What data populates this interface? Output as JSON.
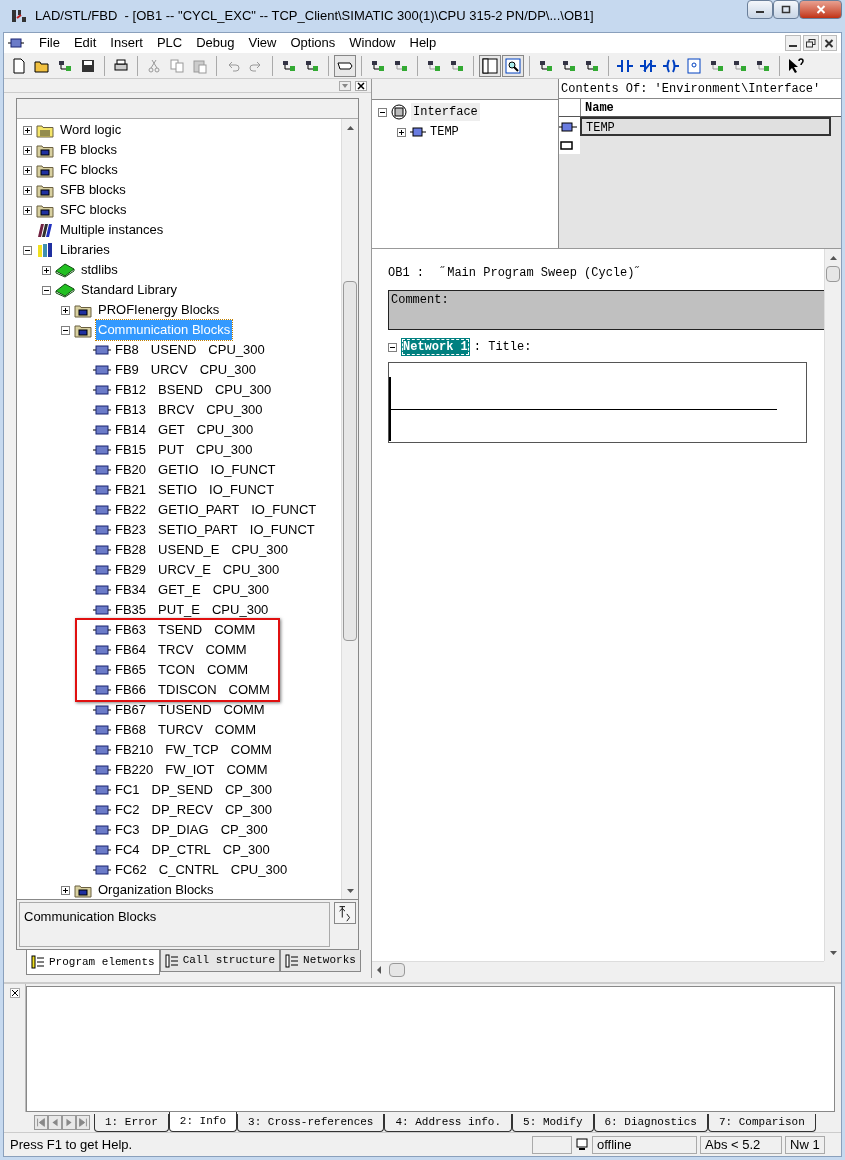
{
  "window": {
    "title": "LAD/STL/FBD  - [OB1 -- \"CYCL_EXC\" -- TCP_Client\\SIMATIC 300(1)\\CPU 315-2 PN/DP\\...\\OB1]"
  },
  "menu": [
    "File",
    "Edit",
    "Insert",
    "PLC",
    "Debug",
    "View",
    "Options",
    "Window",
    "Help"
  ],
  "tree": [
    {
      "label": "Word logic",
      "kind": "logic",
      "expanded": false,
      "selected": false
    },
    {
      "label": "FB blocks",
      "kind": "folder",
      "expanded": false,
      "selected": false
    },
    {
      "label": "FC blocks",
      "kind": "folder",
      "expanded": false,
      "selected": false
    },
    {
      "label": "SFB blocks",
      "kind": "folder",
      "expanded": false,
      "selected": false
    },
    {
      "label": "SFC blocks",
      "kind": "folder",
      "expanded": false,
      "selected": false
    },
    {
      "label": "Multiple instances",
      "kind": "instances",
      "selected": false
    },
    {
      "label": "Libraries",
      "kind": "libraries",
      "expanded": true,
      "selected": false,
      "children": [
        {
          "label": "stdlibs",
          "kind": "book",
          "expanded": false,
          "selected": false
        },
        {
          "label": "Standard Library",
          "kind": "book",
          "expanded": true,
          "selected": false,
          "children": [
            {
              "label": "PROFIenergy Blocks",
              "kind": "folder",
              "expanded": false,
              "selected": false
            },
            {
              "label": "Communication Blocks",
              "kind": "folder",
              "expanded": true,
              "selected": true,
              "blocks": [
                {
                  "number": "FB8",
                  "name": "USEND",
                  "family": "CPU_300",
                  "highlighted": false
                },
                {
                  "number": "FB9",
                  "name": "URCV",
                  "family": "CPU_300",
                  "highlighted": false
                },
                {
                  "number": "FB12",
                  "name": "BSEND",
                  "family": "CPU_300",
                  "highlighted": false
                },
                {
                  "number": "FB13",
                  "name": "BRCV",
                  "family": "CPU_300",
                  "highlighted": false
                },
                {
                  "number": "FB14",
                  "name": "GET",
                  "family": "CPU_300",
                  "highlighted": false
                },
                {
                  "number": "FB15",
                  "name": "PUT",
                  "family": "CPU_300",
                  "highlighted": false
                },
                {
                  "number": "FB20",
                  "name": "GETIO",
                  "family": "IO_FUNCT",
                  "highlighted": false
                },
                {
                  "number": "FB21",
                  "name": "SETIO",
                  "family": "IO_FUNCT",
                  "highlighted": false
                },
                {
                  "number": "FB22",
                  "name": "GETIO_PART",
                  "family": "IO_FUNCT",
                  "highlighted": false
                },
                {
                  "number": "FB23",
                  "name": "SETIO_PART",
                  "family": "IO_FUNCT",
                  "highlighted": false
                },
                {
                  "number": "FB28",
                  "name": "USEND_E",
                  "family": "CPU_300",
                  "highlighted": false
                },
                {
                  "number": "FB29",
                  "name": "URCV_E",
                  "family": "CPU_300",
                  "highlighted": false
                },
                {
                  "number": "FB34",
                  "name": "GET_E",
                  "family": "CPU_300",
                  "highlighted": false
                },
                {
                  "number": "FB35",
                  "name": "PUT_E",
                  "family": "CPU_300",
                  "highlighted": false
                },
                {
                  "number": "FB63",
                  "name": "TSEND",
                  "family": "COMM",
                  "highlighted": true
                },
                {
                  "number": "FB64",
                  "name": "TRCV",
                  "family": "COMM",
                  "highlighted": true
                },
                {
                  "number": "FB65",
                  "name": "TCON",
                  "family": "COMM",
                  "highlighted": true
                },
                {
                  "number": "FB66",
                  "name": "TDISCON",
                  "family": "COMM",
                  "highlighted": true
                },
                {
                  "number": "FB67",
                  "name": "TUSEND",
                  "family": "COMM",
                  "highlighted": false
                },
                {
                  "number": "FB68",
                  "name": "TURCV",
                  "family": "COMM",
                  "highlighted": false
                },
                {
                  "number": "FB210",
                  "name": "FW_TCP",
                  "family": "COMM",
                  "highlighted": false
                },
                {
                  "number": "FB220",
                  "name": "FW_IOT",
                  "family": "COMM",
                  "highlighted": false
                },
                {
                  "number": "FC1",
                  "name": "DP_SEND",
                  "family": "CP_300",
                  "highlighted": false
                },
                {
                  "number": "FC2",
                  "name": "DP_RECV",
                  "family": "CP_300",
                  "highlighted": false
                },
                {
                  "number": "FC3",
                  "name": "DP_DIAG",
                  "family": "CP_300",
                  "highlighted": false
                },
                {
                  "number": "FC4",
                  "name": "DP_CTRL",
                  "family": "CP_300",
                  "highlighted": false
                },
                {
                  "number": "FC62",
                  "name": "C_CNTRL",
                  "family": "CPU_300",
                  "highlighted": false
                }
              ]
            },
            {
              "label": "Organization Blocks",
              "kind": "folder",
              "expanded": false,
              "selected": false
            }
          ]
        }
      ]
    }
  ],
  "tree_info": "Communication Blocks",
  "left_tabs": [
    {
      "label": "Program elements",
      "selected": true
    },
    {
      "label": "Call structure",
      "selected": false
    },
    {
      "label": "Networks",
      "selected": false
    }
  ],
  "interface": {
    "tree": [
      {
        "label": "Interface",
        "expanded": true,
        "children": [
          {
            "label": "TEMP",
            "expanded": false
          }
        ]
      }
    ],
    "contents_title": "Contents Of: 'Environment\\Interface'",
    "column": "Name",
    "rows": [
      {
        "name": "TEMP",
        "selected": true
      }
    ]
  },
  "editor": {
    "block": "OB1 :",
    "title": "˝Main Program Sweep (Cycle)˝",
    "comment": "Comment:",
    "networks": [
      {
        "label": "Network 1",
        "title": ": Title:",
        "expanded": true
      }
    ]
  },
  "bottom_tabs": [
    {
      "label": "1: Error",
      "selected": false
    },
    {
      "label": "2: Info",
      "selected": true
    },
    {
      "label": "3: Cross-references",
      "selected": false
    },
    {
      "label": "4: Address info.",
      "selected": false
    },
    {
      "label": "5: Modify",
      "selected": false
    },
    {
      "label": "6: Diagnostics",
      "selected": false
    },
    {
      "label": "7: Comparison",
      "selected": false
    }
  ],
  "status_bar": {
    "help": "Press F1 to get Help.",
    "mode": "offline",
    "version": "Abs < 5.2",
    "network": "Nw 1"
  }
}
